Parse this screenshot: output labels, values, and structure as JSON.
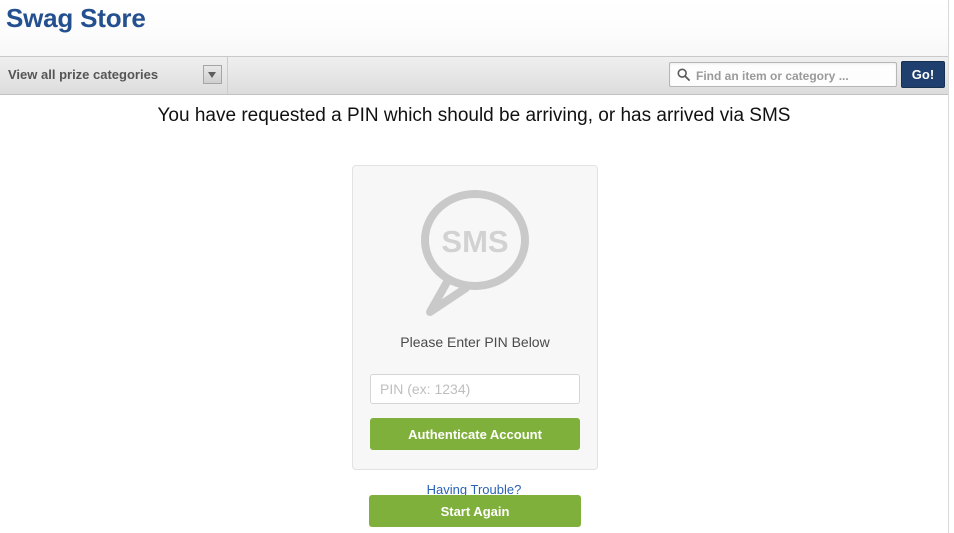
{
  "header": {
    "site_title": "Swag Store",
    "title_color": "#24508f"
  },
  "navbar": {
    "category_dropdown": {
      "label": "View all prize categories",
      "arrow_icon": "chevron-down-icon"
    },
    "search": {
      "icon": "search-icon",
      "placeholder": "Find an item or category ...",
      "value": "",
      "submit_label": "Go!",
      "submit_color": "#1f3f6e"
    }
  },
  "main": {
    "heading": "You have requested a PIN which should be arriving, or has arrived via SMS",
    "card": {
      "icon": "sms-bubble-icon",
      "icon_text": "SMS",
      "prompt": "Please Enter PIN Below",
      "pin_input": {
        "placeholder": "PIN (ex: 1234)",
        "value": ""
      },
      "authenticate_label": "Authenticate Account",
      "button_color": "#80b03c"
    },
    "having_trouble_link": "Having Trouble?",
    "start_again_label": "Start Again"
  }
}
